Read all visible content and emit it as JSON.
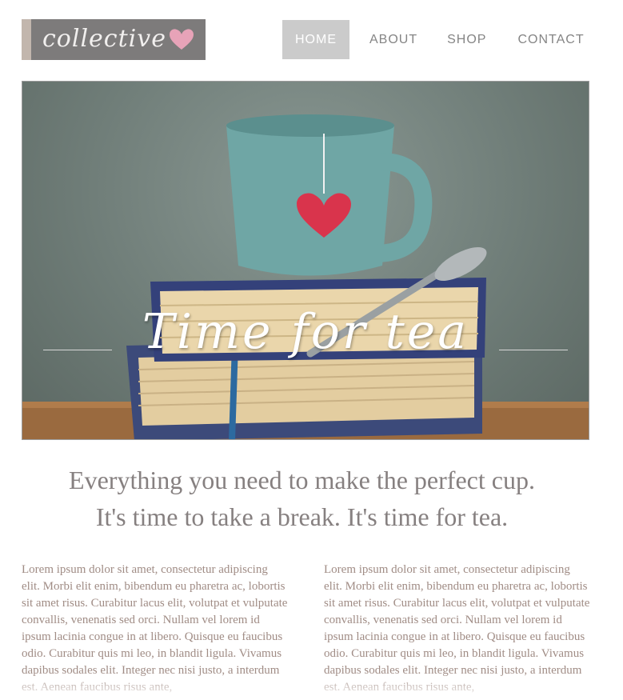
{
  "logo": {
    "text": "collectivе"
  },
  "nav": {
    "items": [
      {
        "label": "HOME",
        "active": true
      },
      {
        "label": "ABOUT",
        "active": false
      },
      {
        "label": "SHOP",
        "active": false
      },
      {
        "label": "CONTACT",
        "active": false
      }
    ]
  },
  "hero": {
    "title": "Time for tea"
  },
  "tagline": {
    "line1": "Everything you need to make the perfect cup.",
    "line2": "It's time to take a break. It's time for tea."
  },
  "columns": [
    {
      "text": "Lorem ipsum dolor sit amet, consectetur adipiscing elit. Morbi elit enim, bibendum eu pharetra ac, lobortis sit amet risus. Curabitur lacus elit, volutpat et vulputate convallis, venenatis sed orci. Nullam vel lorem id ipsum lacinia congue in at libero. Quisque eu faucibus odio. Curabitur quis mi leo, in blandit ligula. Vivamus dapibus sodales elit. Integer nec nisi justo, a interdum est. Aenean faucibus risus ante,"
    },
    {
      "text": "Lorem ipsum dolor sit amet, consectetur adipiscing elit. Morbi elit enim, bibendum eu pharetra ac, lobortis sit amet risus. Curabitur lacus elit, volutpat et vulputate convallis, venenatis sed orci. Nullam vel lorem id ipsum lacinia congue in at libero. Quisque eu faucibus odio. Curabitur quis mi leo, in blandit ligula. Vivamus dapibus sodales elit. Integer nec nisi justo, a interdum est. Aenean faucibus risus ante,"
    }
  ],
  "colors": {
    "logo_bg": "#7d7b7b",
    "logo_accent": "#c2b6ad",
    "heart": "#e7a3b8",
    "nav_active_bg": "#cbcbcb",
    "text_gray": "#868080",
    "body_text": "#a08c85"
  },
  "icons": {
    "logo_heart": "heart-icon"
  }
}
